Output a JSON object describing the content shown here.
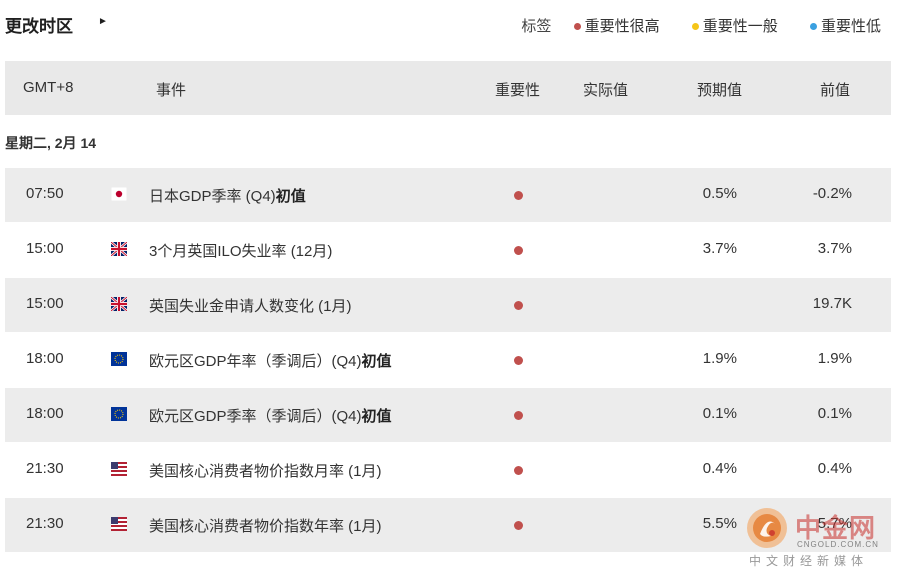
{
  "topbar": {
    "timezone_change_label": "更改时区",
    "timezone_arrow": "►",
    "legend": {
      "title": "标签",
      "items": [
        {
          "label": "重要性很高",
          "color": "#c0504d"
        },
        {
          "label": "重要性一般",
          "color": "#f5c518"
        },
        {
          "label": "重要性低",
          "color": "#3aa0e0"
        }
      ]
    }
  },
  "table": {
    "headers": {
      "time": "GMT+8",
      "event": "事件",
      "importance": "重要性",
      "actual": "实际值",
      "forecast": "预期值",
      "previous": "前值"
    },
    "day_label": "星期二, 2月 14",
    "rows": [
      {
        "time": "07:50",
        "flag": "jp-flag-icon",
        "event": "日本GDP季率 (Q4)",
        "event_bold": "初值",
        "importance_color": "#c0504d",
        "actual": "",
        "forecast": "0.5%",
        "previous": "-0.2%"
      },
      {
        "time": "15:00",
        "flag": "uk-flag-icon",
        "event": "3个月英国ILO失业率 (12月)",
        "event_bold": "",
        "importance_color": "#c0504d",
        "actual": "",
        "forecast": "3.7%",
        "previous": "3.7%"
      },
      {
        "time": "15:00",
        "flag": "uk-flag-icon",
        "event": "英国失业金申请人数变化 (1月)",
        "event_bold": "",
        "importance_color": "#c0504d",
        "actual": "",
        "forecast": "",
        "previous": "19.7K"
      },
      {
        "time": "18:00",
        "flag": "eu-flag-icon",
        "event": "欧元区GDP年率（季调后）(Q4)",
        "event_bold": "初值",
        "importance_color": "#c0504d",
        "actual": "",
        "forecast": "1.9%",
        "previous": "1.9%"
      },
      {
        "time": "18:00",
        "flag": "eu-flag-icon",
        "event": "欧元区GDP季率（季调后）(Q4)",
        "event_bold": "初值",
        "importance_color": "#c0504d",
        "actual": "",
        "forecast": "0.1%",
        "previous": "0.1%"
      },
      {
        "time": "21:30",
        "flag": "us-flag-icon",
        "event": "美国核心消费者物价指数月率 (1月)",
        "event_bold": "",
        "importance_color": "#c0504d",
        "actual": "",
        "forecast": "0.4%",
        "previous": "0.4%"
      },
      {
        "time": "21:30",
        "flag": "us-flag-icon",
        "event": "美国核心消费者物价指数年率 (1月)",
        "event_bold": "",
        "importance_color": "#c0504d",
        "actual": "",
        "forecast": "5.5%",
        "previous": "5.7%"
      }
    ]
  },
  "watermark": {
    "brand": "中金网",
    "url": "CNGOLD.COM.CN",
    "tagline": "中文财经新媒体"
  }
}
